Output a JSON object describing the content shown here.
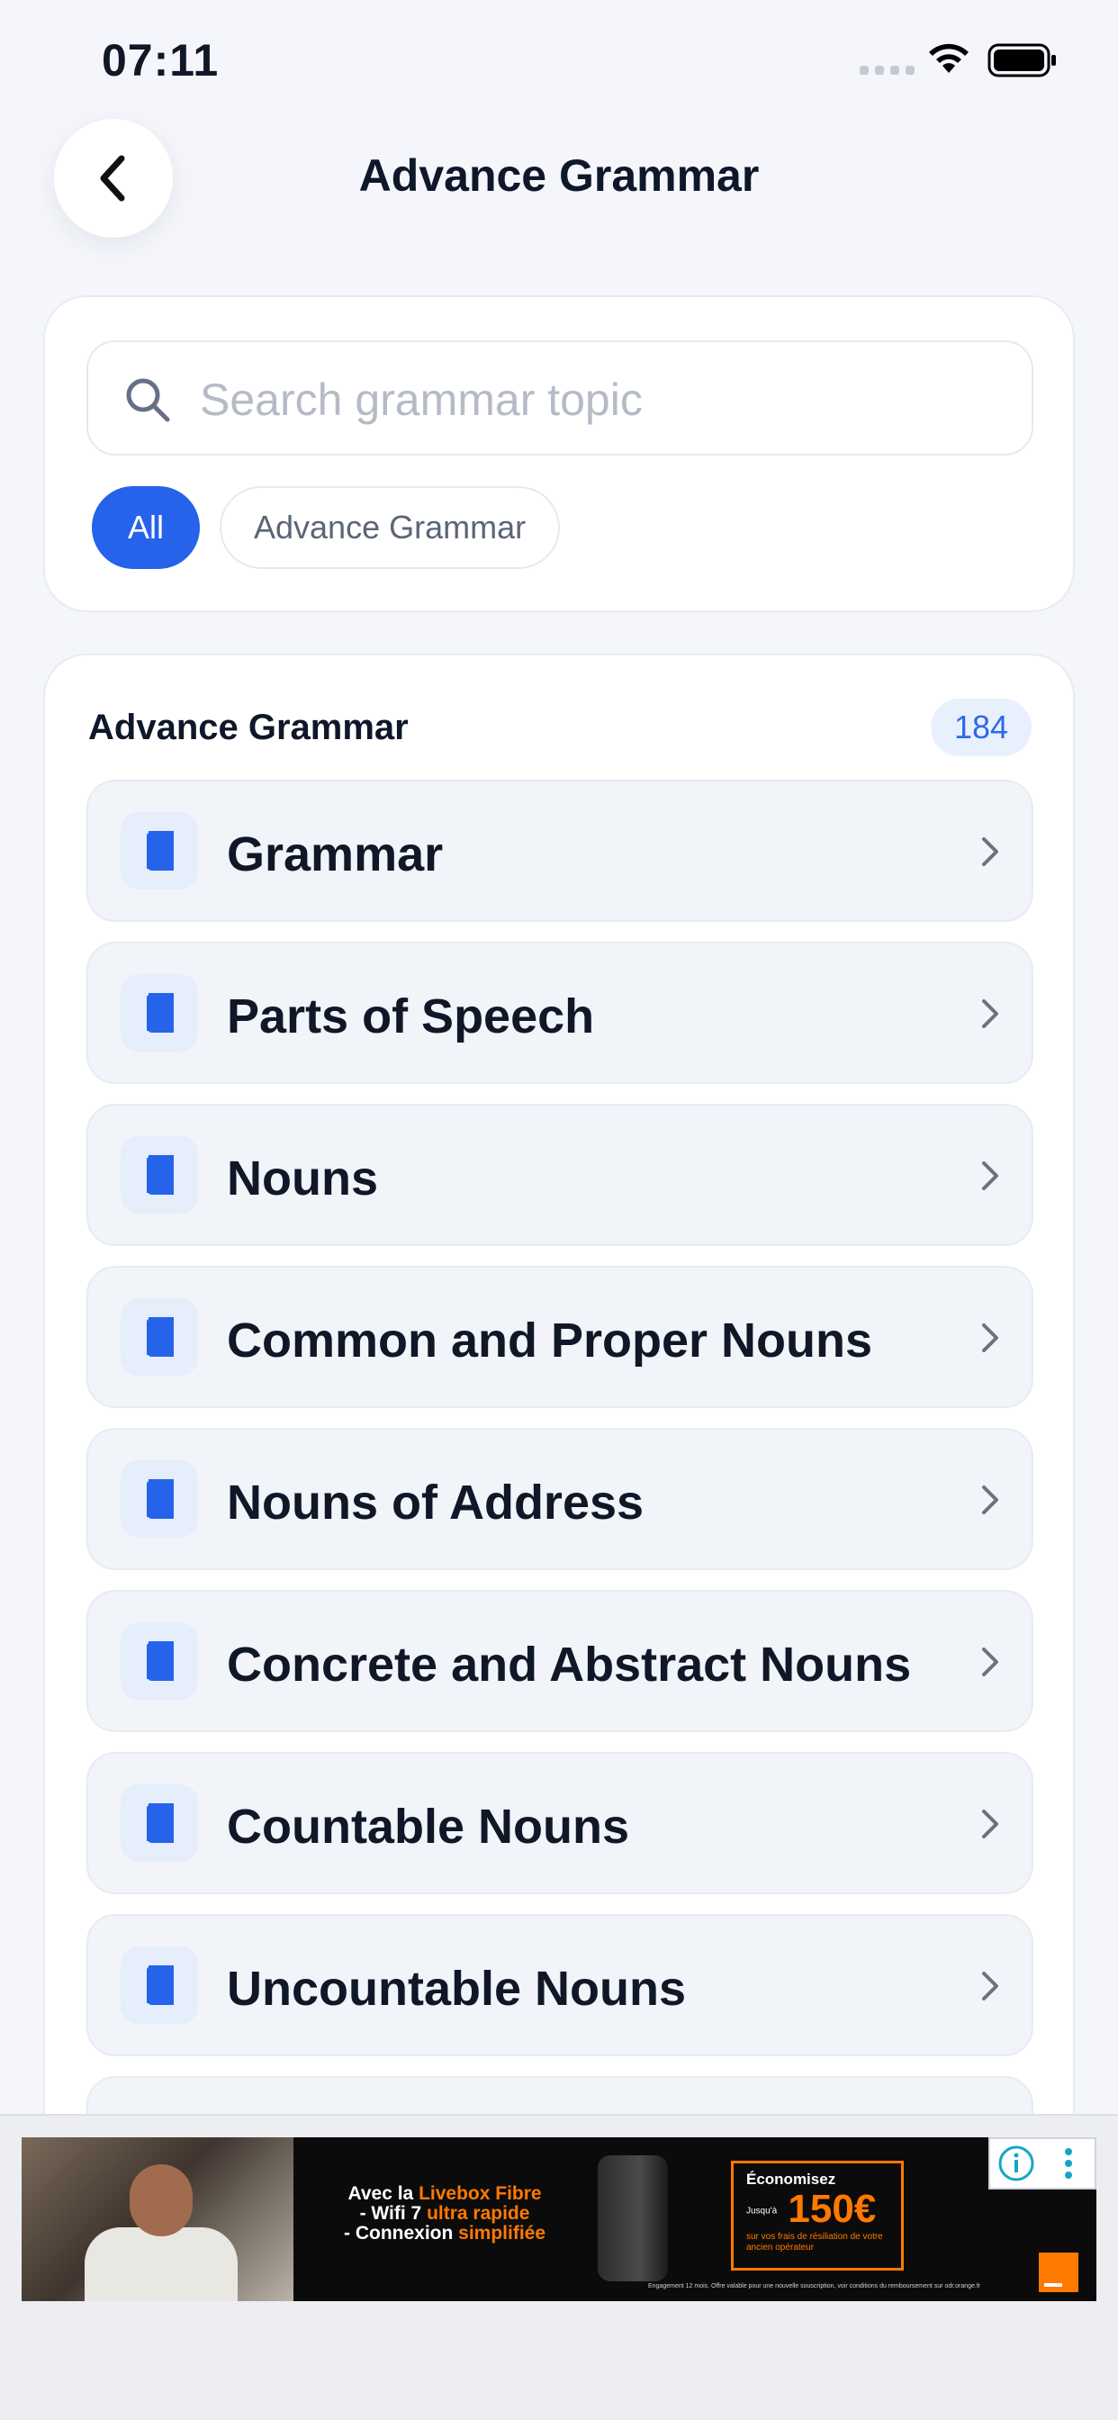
{
  "status_bar": {
    "time": "07:11"
  },
  "header": {
    "title": "Advance Grammar"
  },
  "search": {
    "placeholder": "Search grammar topic",
    "value": ""
  },
  "filters": [
    {
      "label": "All",
      "active": true
    },
    {
      "label": "Advance Grammar",
      "active": false
    }
  ],
  "section": {
    "title": "Advance Grammar",
    "count": "184",
    "items": [
      {
        "label": "Grammar"
      },
      {
        "label": "Parts of Speech"
      },
      {
        "label": "Nouns"
      },
      {
        "label": "Common and Proper Nouns"
      },
      {
        "label": "Nouns of Address"
      },
      {
        "label": "Concrete and Abstract Nouns"
      },
      {
        "label": "Countable Nouns"
      },
      {
        "label": "Uncountable Nouns"
      },
      {
        "label": ""
      }
    ]
  },
  "ad": {
    "line1_a": "Avec la ",
    "line1_b": "Livebox Fibre",
    "line2_a": "- Wifi 7 ",
    "line2_b": "ultra rapide",
    "line3_a": "- Connexion ",
    "line3_b": "simplifiée",
    "offer_title": "Économisez",
    "offer_prefix": "Jusqu'à",
    "offer_amount": "150€",
    "offer_sub": "sur vos frais de résiliation de votre ancien opérateur",
    "legal": "Engagement 12 mois. Offre valable pour une nouvelle souscription, voir conditions du remboursement sur odr.orange.fr"
  },
  "colors": {
    "accent": "#2563eb",
    "badge_bg": "#e9f0fd",
    "brand_orange": "#ff7900"
  }
}
